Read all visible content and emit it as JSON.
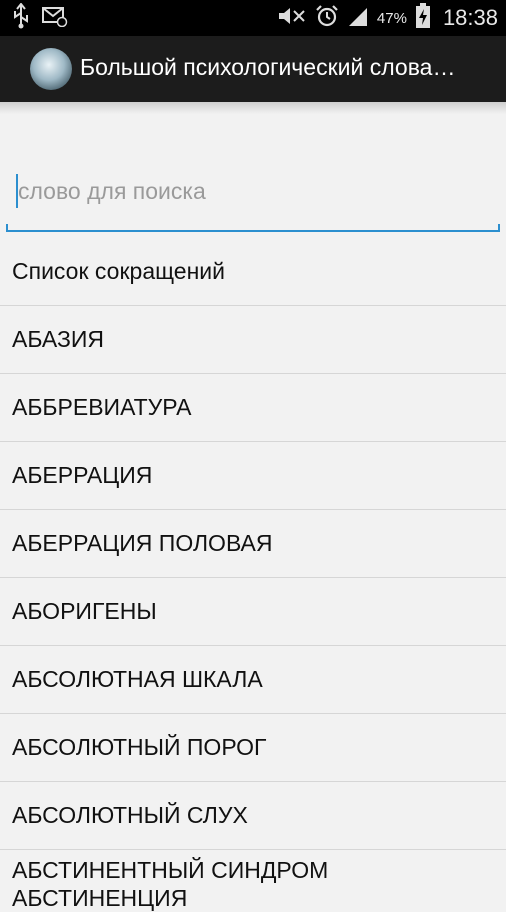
{
  "status_bar": {
    "icons": [
      "usb-icon",
      "email-icon",
      "mute-icon",
      "alarm-icon",
      "signal-icon",
      "battery-charging-icon"
    ],
    "battery_percent": "47%",
    "time": "18:38"
  },
  "action_bar": {
    "title": "Большой психологический слова…"
  },
  "search": {
    "placeholder": "слово для поиска",
    "value": ""
  },
  "list": {
    "items": [
      "Список сокращений",
      "АБАЗИЯ",
      "АББРЕВИАТУРА",
      "АБЕРРАЦИЯ",
      "АБЕРРАЦИЯ ПОЛОВАЯ",
      "АБОРИГЕНЫ",
      "АБСОЛЮТНАЯ ШКАЛА",
      "АБСОЛЮТНЫЙ ПОРОГ",
      "АБСОЛЮТНЫЙ СЛУХ",
      "АБСТИНЕНТНЫЙ СИНДРОМ АБСТИНЕНЦИЯ"
    ]
  },
  "colors": {
    "accent": "#2c8fcf",
    "action_bar": "#1c1c1c",
    "background": "#f2f2f2"
  }
}
